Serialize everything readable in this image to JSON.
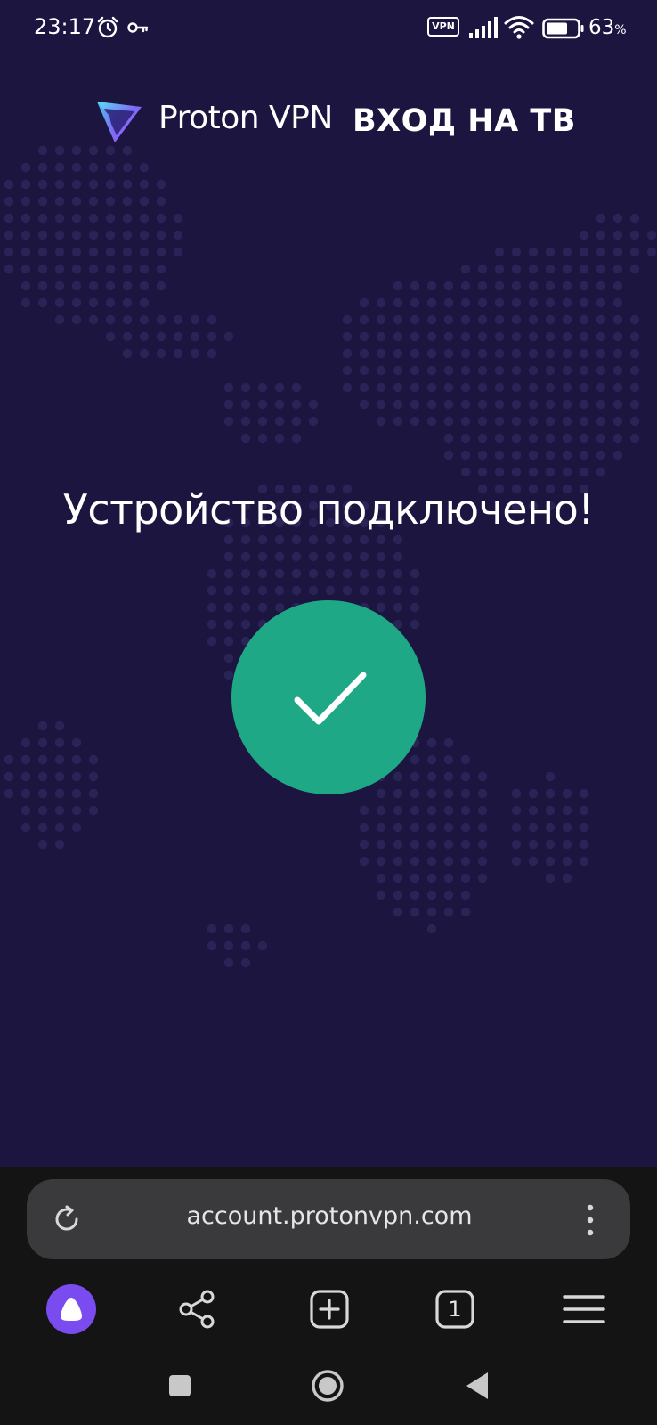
{
  "status_bar": {
    "time": "23:17",
    "vpn_badge": "VPN",
    "battery_level": "63",
    "battery_unit": "%",
    "icons": [
      "alarm-icon",
      "key-icon",
      "vpn-icon",
      "signal-icon",
      "wifi-icon",
      "battery-icon"
    ]
  },
  "header": {
    "brand": "Proton VPN",
    "title": "ВХОД НА ТВ"
  },
  "main": {
    "headline": "Устройство подключено!",
    "status_icon": "checkmark-icon"
  },
  "browser": {
    "url": "account.protonvpn.com",
    "tab_count": "1",
    "toolbar_icons": [
      "alice-icon",
      "share-icon",
      "new-tab-icon",
      "tabs-icon",
      "hamburger-menu-icon"
    ]
  },
  "colors": {
    "page_background": "#1b1540",
    "success_green": "#1fa886",
    "browser_panel": "#141414",
    "address_bar": "#3a3a3c",
    "alice_purple": "#7a4cf0"
  }
}
